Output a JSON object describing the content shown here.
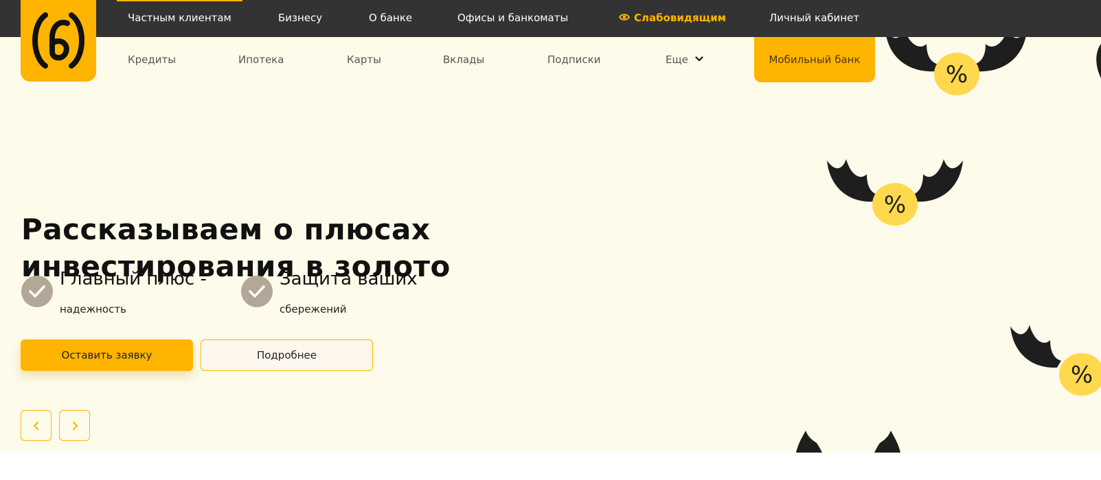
{
  "top_nav": {
    "items": [
      {
        "label": "Частным клиентам",
        "active": true
      },
      {
        "label": "Бизнесу"
      },
      {
        "label": "О банке"
      },
      {
        "label": "Офисы и банкоматы"
      },
      {
        "label": "Слабовидящим",
        "icon": "eye-icon",
        "accent": true
      },
      {
        "label": "Личный кабинет"
      }
    ]
  },
  "logo": {
    "icon": "bank-logo-icon"
  },
  "sub_nav": {
    "items": [
      "Кредиты",
      "Ипотека",
      "Карты",
      "Вклады",
      "Подписки"
    ],
    "more_label": "Еще",
    "mobile_bank_label": "Мобильный банк"
  },
  "hero": {
    "title_line1": "Рассказываем о плюсах",
    "title_line2": "инвестирования в золото",
    "features": [
      {
        "title": "Главный плюс -",
        "subtitle": "надежность",
        "icon": "check-icon"
      },
      {
        "title": "Защита ваших",
        "subtitle": "сбережений",
        "icon": "check-icon"
      }
    ],
    "primary_button": "Оставить заявку",
    "secondary_button": "Подробнее",
    "decoration_text": "%"
  },
  "colors": {
    "accent": "#ffb400",
    "topbar": "#333333",
    "hero_bg": "#fefbea",
    "check_bg": "#b3a898",
    "coin": "#ffd84d",
    "wing": "#1e1e1e"
  }
}
